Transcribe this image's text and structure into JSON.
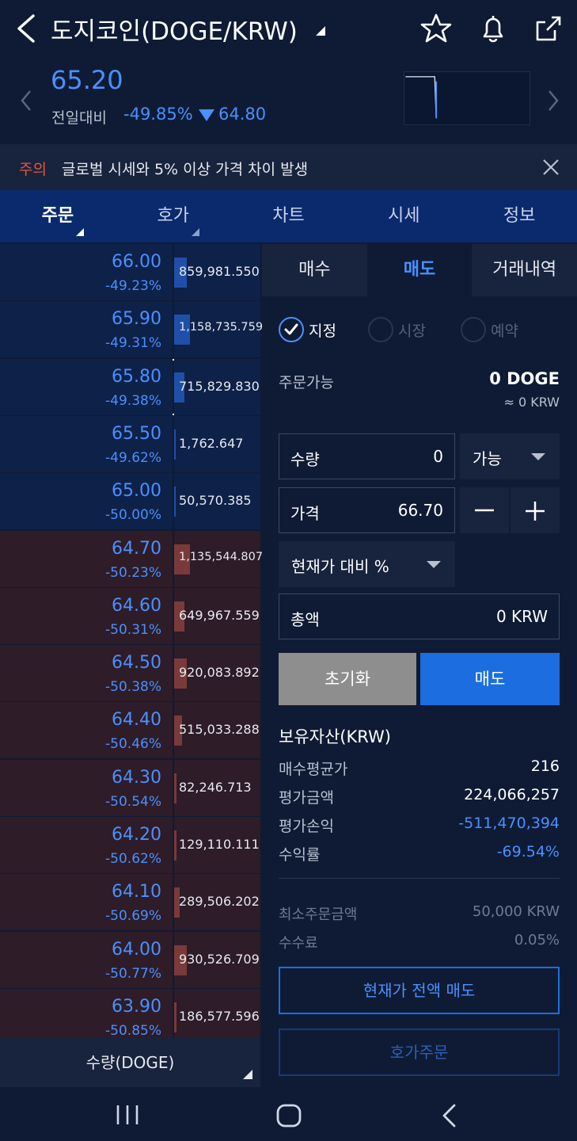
{
  "header": {
    "title": "도지코인(DOGE/KRW)",
    "icons": [
      "back-chevron-icon",
      "star-icon",
      "bell-icon",
      "share-icon"
    ]
  },
  "price": {
    "current": "65.20",
    "compare_label": "전일대비",
    "change_pct": "-49.85%",
    "change_amount": "64.80",
    "color": "#4a90ff"
  },
  "warning": {
    "tag": "주의",
    "text": "글로벌 시세와 5% 이상 가격 차이 발생"
  },
  "tabs": [
    {
      "label": "주문",
      "active": true
    },
    {
      "label": "호가",
      "active": false
    },
    {
      "label": "차트",
      "active": false
    },
    {
      "label": "시세",
      "active": false
    },
    {
      "label": "정보",
      "active": false
    }
  ],
  "orderbook": {
    "rows": [
      {
        "side": "ask",
        "price": "66.00",
        "pct": "-49.23%",
        "volume": "859,981.550",
        "fill": 0.05
      },
      {
        "side": "ask",
        "price": "65.90",
        "pct": "-49.31%",
        "volume": "1,158,735.759",
        "fill": 0.06
      },
      {
        "side": "ask",
        "price": "65.80",
        "pct": "-49.38%",
        "volume": "715,829.830",
        "fill": 0.04,
        "selected": true
      },
      {
        "side": "ask",
        "price": "65.50",
        "pct": "-49.62%",
        "volume": "1,762.647",
        "fill": 0.0
      },
      {
        "side": "ask",
        "price": "65.00",
        "pct": "-50.00%",
        "volume": "50,570.385",
        "fill": 0.0
      },
      {
        "side": "bid",
        "price": "64.70",
        "pct": "-50.23%",
        "volume": "1,135,544.807",
        "fill": 0.06
      },
      {
        "side": "bid",
        "price": "64.60",
        "pct": "-50.31%",
        "volume": "649,967.559",
        "fill": 0.04
      },
      {
        "side": "bid",
        "price": "64.50",
        "pct": "-50.38%",
        "volume": "920,083.892",
        "fill": 0.05
      },
      {
        "side": "bid",
        "price": "64.40",
        "pct": "-50.46%",
        "volume": "515,033.288",
        "fill": 0.03
      },
      {
        "side": "bid",
        "price": "64.30",
        "pct": "-50.54%",
        "volume": "82,246.713",
        "fill": 0.01
      },
      {
        "side": "bid",
        "price": "64.20",
        "pct": "-50.62%",
        "volume": "129,110.111",
        "fill": 0.01
      },
      {
        "side": "bid",
        "price": "64.10",
        "pct": "-50.69%",
        "volume": "289,506.202",
        "fill": 0.02
      },
      {
        "side": "bid",
        "price": "64.00",
        "pct": "-50.77%",
        "volume": "930,526.709",
        "fill": 0.05
      },
      {
        "side": "bid",
        "price": "63.90",
        "pct": "-50.85%",
        "volume": "186,577.596",
        "fill": 0.01
      }
    ],
    "qty_toggle": "수량(DOGE)"
  },
  "order": {
    "tabs": [
      {
        "label": "매수",
        "active": false
      },
      {
        "label": "매도",
        "active": true
      },
      {
        "label": "거래내역",
        "active": false
      }
    ],
    "types": [
      {
        "label": "지정",
        "checked": true
      },
      {
        "label": "시장",
        "checked": false
      },
      {
        "label": "예약",
        "checked": false
      }
    ],
    "available_label": "주문가능",
    "available_value": "0 DOGE",
    "available_krw": "≈ 0 KRW",
    "qty_label": "수량",
    "qty_value": "0",
    "qty_dropdown": "가능",
    "price_label": "가격",
    "price_value": "66.70",
    "pct_dropdown": "현재가 대비 %",
    "total_label": "총액",
    "total_value": "0 KRW",
    "reset_label": "초기화",
    "sell_label": "매도",
    "holdings_title": "보유자산(KRW)",
    "holdings": [
      {
        "label": "매수평균가",
        "value": "216",
        "blue": false
      },
      {
        "label": "평가금액",
        "value": "224,066,257",
        "blue": false
      },
      {
        "label": "평가손익",
        "value": "-511,470,394",
        "blue": true
      },
      {
        "label": "수익률",
        "value": "-69.54%",
        "blue": true
      }
    ],
    "meta": [
      {
        "label": "최소주문금액",
        "value": "50,000 KRW"
      },
      {
        "label": "수수료",
        "value": "0.05%"
      }
    ],
    "sell_all_label": "현재가 전액 매도",
    "hoga_order_label": "호가주문"
  }
}
